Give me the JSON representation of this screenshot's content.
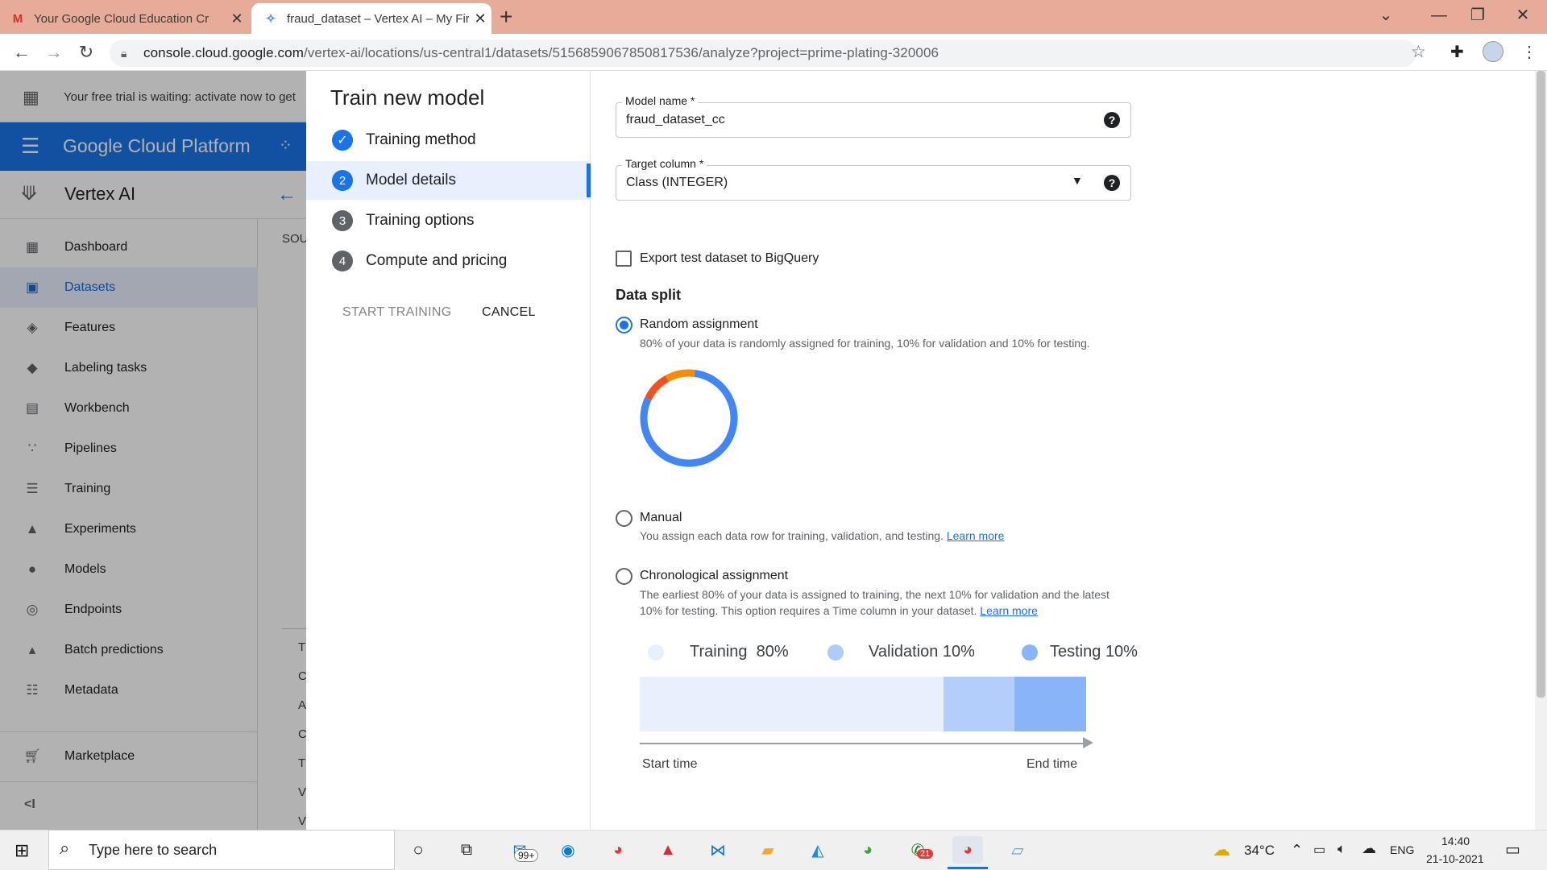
{
  "browser": {
    "tabs": [
      {
        "title": "Your Google Cloud Education Cr",
        "favicon": "M"
      },
      {
        "title": "fraud_dataset – Vertex AI – My Fir",
        "favicon": "✧"
      }
    ],
    "new_tab": "+",
    "url_host": "console.cloud.google.com",
    "url_path": "/vertex-ai/locations/us-central1/datasets/5156859067850817536/analyze?project=prime-plating-320006"
  },
  "gcp": {
    "trial_banner": "Your free trial is waiting: activate now to get",
    "platform_title": "Google Cloud Platform",
    "product": "Vertex AI",
    "nav": [
      {
        "label": "Dashboard",
        "icon": "▦"
      },
      {
        "label": "Datasets",
        "icon": "▣"
      },
      {
        "label": "Features",
        "icon": "◈"
      },
      {
        "label": "Labeling tasks",
        "icon": "◆"
      },
      {
        "label": "Workbench",
        "icon": "▤"
      },
      {
        "label": "Pipelines",
        "icon": "∵"
      },
      {
        "label": "Training",
        "icon": "☰"
      },
      {
        "label": "Experiments",
        "icon": "▲"
      },
      {
        "label": "Models",
        "icon": "●"
      },
      {
        "label": "Endpoints",
        "icon": "◎"
      },
      {
        "label": "Batch predictions",
        "icon": "▴"
      },
      {
        "label": "Metadata",
        "icon": "☷"
      }
    ],
    "marketplace": "Marketplace",
    "collapse": "<I",
    "peek_tab": "SOU",
    "peek_rows": [
      "T",
      "C",
      "A",
      "C",
      "T",
      "V",
      "V"
    ]
  },
  "dialog": {
    "title": "Train new model",
    "steps": [
      {
        "num": "✓",
        "label": "Training method"
      },
      {
        "num": "2",
        "label": "Model details"
      },
      {
        "num": "3",
        "label": "Training options"
      },
      {
        "num": "4",
        "label": "Compute and pricing"
      }
    ],
    "start_training": "START TRAINING",
    "cancel": "CANCEL"
  },
  "form": {
    "model_name_label": "Model name *",
    "model_name_value": "fraud_dataset_cc",
    "target_column_label": "Target column *",
    "target_column_value": "Class (INTEGER)",
    "export_label": "Export test dataset to BigQuery",
    "data_split_title": "Data split",
    "random_label": "Random assignment",
    "random_desc": "80% of your data is randomly assigned for training, 10% for validation and 10% for testing.",
    "manual_label": "Manual",
    "manual_desc": "You assign each data row for training, validation, and testing.",
    "learn_more": "Learn more",
    "chrono_label": "Chronological assignment",
    "chrono_desc_1": "The earliest 80% of your data is assigned to training, the next 10% for validation and the latest",
    "chrono_desc_2": "10% for testing. This option requires a Time column in your dataset.",
    "legend": [
      {
        "label": "Training",
        "pct": "80%",
        "color": "#e8f0fe"
      },
      {
        "label": "Validation",
        "pct": "10%",
        "color": "#aecbfa"
      },
      {
        "label": "Testing",
        "pct": "10%",
        "color": "#8ab4f8"
      }
    ],
    "start_time": "Start time",
    "end_time": "End time",
    "donut": [
      {
        "name": "Training",
        "fraction": 0.8,
        "color": "#4285f4"
      },
      {
        "name": "Validation",
        "fraction": 0.1,
        "color": "#f4511e"
      },
      {
        "name": "Testing",
        "fraction": 0.1,
        "color": "#fb8c00"
      }
    ],
    "timeline": [
      {
        "name": "Training",
        "fraction": 0.68,
        "color": "#e8f0fe"
      },
      {
        "name": "Validation",
        "fraction": 0.16,
        "color": "#b3cefb"
      },
      {
        "name": "Testing",
        "fraction": 0.16,
        "color": "#8ab4f8"
      }
    ]
  },
  "taskbar": {
    "search_placeholder": "Type here to search",
    "mail_badge": "99+",
    "whatsapp_badge": "21",
    "temperature": "34°C",
    "language": "ENG",
    "time": "14:40",
    "date": "21-10-2021"
  }
}
